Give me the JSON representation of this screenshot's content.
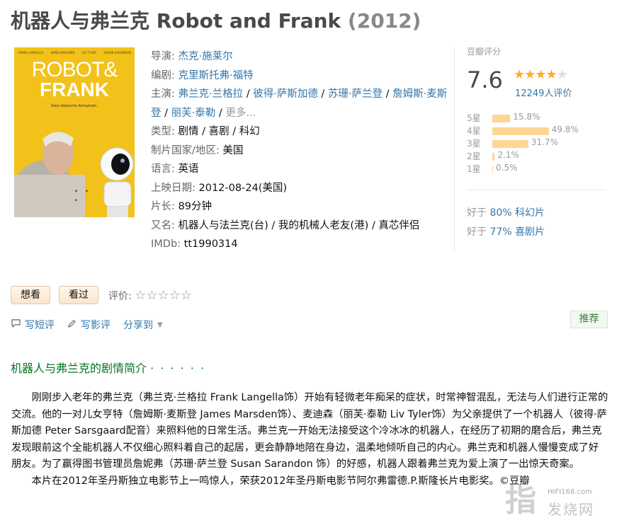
{
  "header": {
    "title": "机器人与弗兰克 Robot and Frank",
    "year": "(2012)"
  },
  "poster": {
    "credits": [
      "FRANK LANGELLA",
      "JAMES MARSDEN",
      "LIV TYLER",
      "SUSAN SARANDON"
    ],
    "title_line1": "ROBOT&",
    "title_line2": "FRANK",
    "tagline": "Zwei diebische Komplizen."
  },
  "info": {
    "director_label": "导演:",
    "director": "杰克·施莱尔",
    "writer_label": "编剧:",
    "writer": "克里斯托弗·福特",
    "cast_label": "主演:",
    "cast": [
      "弗兰克·兰格拉",
      "彼得·萨斯加德",
      "苏珊·萨兰登",
      "詹姆斯·麦斯登",
      "丽芙·泰勒"
    ],
    "cast_more": "更多...",
    "genre_label": "类型:",
    "genres": [
      "剧情",
      "喜剧",
      "科幻"
    ],
    "country_label": "制片国家/地区:",
    "country": "美国",
    "language_label": "语言:",
    "language": "英语",
    "release_label": "上映日期:",
    "release": "2012-08-24(美国)",
    "runtime_label": "片长:",
    "runtime": "89分钟",
    "aka_label": "又名:",
    "aka": "机器人与法兰克(台) / 我的机械人老友(港) / 真芯伴侣",
    "imdb_label": "IMDb:",
    "imdb": "tt1990314"
  },
  "rating": {
    "header": "豆瓣评分",
    "score": "7.6",
    "stars": 4,
    "count_text": "12249人评价",
    "distribution": [
      {
        "label": "5星",
        "value": 15.8,
        "text": "15.8%"
      },
      {
        "label": "4星",
        "value": 49.8,
        "text": "49.8%"
      },
      {
        "label": "3星",
        "value": 31.7,
        "text": "31.7%"
      },
      {
        "label": "2星",
        "value": 2.1,
        "text": "2.1%"
      },
      {
        "label": "1星",
        "value": 0.5,
        "text": "0.5%"
      }
    ],
    "better_than": [
      {
        "prefix": "好于",
        "link": "80% 科幻片"
      },
      {
        "prefix": "好于",
        "link": "77% 喜剧片"
      }
    ]
  },
  "actions": {
    "want": "想看",
    "seen": "看过",
    "rate_label": "评价:"
  },
  "social": {
    "short_review": "写短评",
    "review": "写影评",
    "share": "分享到"
  },
  "recommend": "推荐",
  "intro": {
    "heading": "机器人与弗兰克的剧情简介",
    "dots": "· · · · · ·",
    "p1": "刚刚步入老年的弗兰克（弗兰克·兰格拉 Frank Langella饰）开始有轻微老年痴呆的症状，时常神智混乱，无法与人们进行正常的交流。他的一对儿女亨特（詹姆斯·麦斯登 James Marsden饰）、麦迪森（丽芙·泰勒 Liv Tyler饰）为父亲提供了一个机器人（彼得·萨斯加德 Peter Sarsgaard配音）来照料他的日常生活。弗兰克一开始无法接受这个冷冰冰的机器人，在经历了初期的磨合后，弗兰克发现眼前这个全能机器人不仅细心照料着自己的起居，更会静静地陪在身边，温柔地倾听自己的内心。弗兰克和机器人慢慢变成了好朋友。为了赢得图书管理员詹妮弗（苏珊·萨兰登 Susan Sarandon 饰）的好感，机器人跟着弗兰克为爱上演了一出惊天奇案。",
    "p2": "本片在2012年圣丹斯独立电影节上一鸣惊人，荣获2012年圣丹斯电影节阿尔弗雷德.P.斯隆长片电影奖。©豆瓣"
  },
  "watermark": {
    "site": "HIFI168.com",
    "cn": "发烧网"
  }
}
